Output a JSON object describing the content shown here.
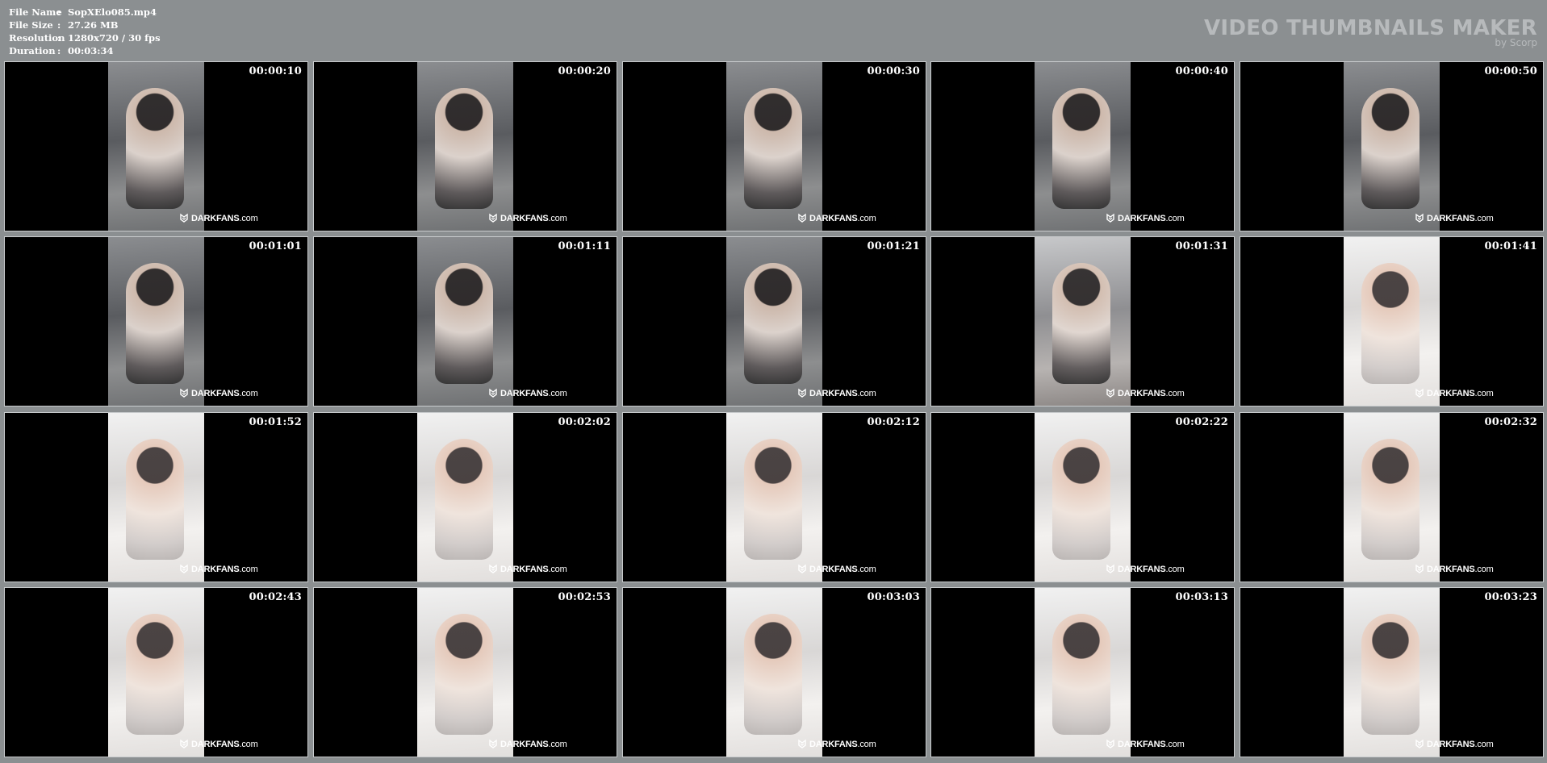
{
  "info": {
    "file_name_label": "File Name",
    "file_name": "SopXElo085.mp4",
    "file_size_label": "File Size",
    "file_size": "27.26 MB",
    "resolution_label": "Resolution",
    "resolution": "1280x720 / 30 fps",
    "duration_label": "Duration",
    "duration": "00:03:34",
    "separator": ":"
  },
  "brand": {
    "title": "VIDEO THUMBNAILS MAKER",
    "subtitle": "by Scorp"
  },
  "watermark": {
    "bold": "DARKFANS",
    "rest": ".com"
  },
  "colors": {
    "background": "#8b8f91",
    "frame_letterbox": "#000000",
    "brand_text": "#b7babc"
  },
  "thumbnails": [
    {
      "time": "00:00:10",
      "tone": "dark"
    },
    {
      "time": "00:00:20",
      "tone": "dark"
    },
    {
      "time": "00:00:30",
      "tone": "dark"
    },
    {
      "time": "00:00:40",
      "tone": "dark"
    },
    {
      "time": "00:00:50",
      "tone": "dark"
    },
    {
      "time": "00:01:01",
      "tone": "dark"
    },
    {
      "time": "00:01:11",
      "tone": "dark"
    },
    {
      "time": "00:01:21",
      "tone": "dark"
    },
    {
      "time": "00:01:31",
      "tone": "mid"
    },
    {
      "time": "00:01:41",
      "tone": "light"
    },
    {
      "time": "00:01:52",
      "tone": "light"
    },
    {
      "time": "00:02:02",
      "tone": "light"
    },
    {
      "time": "00:02:12",
      "tone": "light"
    },
    {
      "time": "00:02:22",
      "tone": "light"
    },
    {
      "time": "00:02:32",
      "tone": "light"
    },
    {
      "time": "00:02:43",
      "tone": "light"
    },
    {
      "time": "00:02:53",
      "tone": "light"
    },
    {
      "time": "00:03:03",
      "tone": "light"
    },
    {
      "time": "00:03:13",
      "tone": "light"
    },
    {
      "time": "00:03:23",
      "tone": "light"
    }
  ]
}
